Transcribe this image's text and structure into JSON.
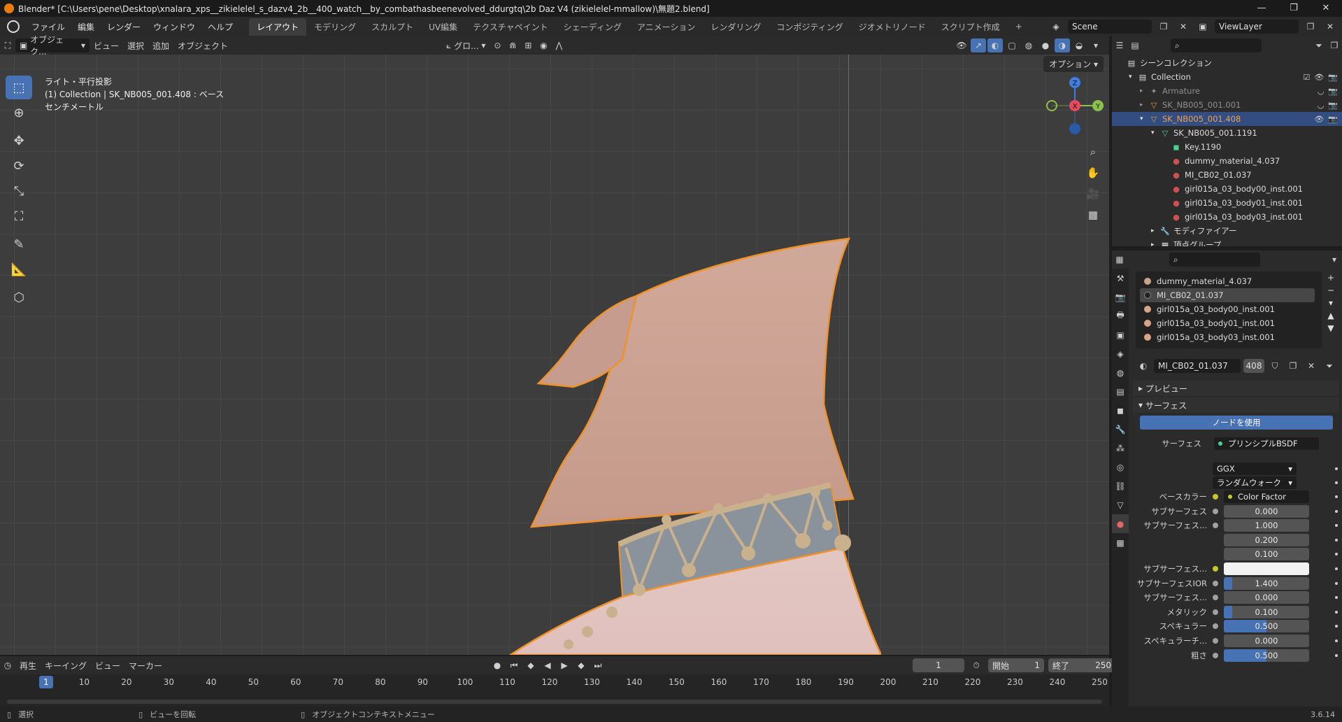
{
  "window": {
    "title": "Blender* [C:\\Users\\pene\\Desktop\\xnalara_xps__zikielelel_s_dazv4_2b__400_watch__by_combathasbeenevolved_ddurgtq\\2b Daz V4 (zikielelel-mmallow)\\無題2.blend]",
    "controls": [
      "—",
      "❐",
      "✕"
    ]
  },
  "menubar": {
    "items": [
      "ファイル",
      "編集",
      "レンダー",
      "ウィンドウ",
      "ヘルプ"
    ],
    "workspaces": [
      "レイアウト",
      "モデリング",
      "スカルプト",
      "UV編集",
      "テクスチャペイント",
      "シェーディング",
      "アニメーション",
      "レンダリング",
      "コンポジティング",
      "ジオメトリノード",
      "スクリプト作成"
    ],
    "active_workspace": "レイアウト",
    "add_tab": "+",
    "scene": "Scene",
    "view_layer": "ViewLayer"
  },
  "viewport_header": {
    "mode": "オブジェク...",
    "menus": [
      "ビュー",
      "選択",
      "追加",
      "オブジェクト"
    ],
    "transform_orientation": "グロ...",
    "options": "オプション"
  },
  "viewport": {
    "info_lines": [
      "ライト・平行投影",
      "(1) Collection | SK_NB005_001.408 : ベース",
      "センチメートル"
    ],
    "gizmo": {
      "z": "Z",
      "x": "X",
      "y": "Y"
    },
    "colors": {
      "x": "#e84a5f",
      "y": "#8bc34a",
      "z": "#3d7fe0",
      "selection_outline": "#f0912a"
    }
  },
  "timeline": {
    "menus": [
      "再生",
      "キーイング",
      "ビュー",
      "マーカー"
    ],
    "current_frame": "1",
    "start_label": "開始",
    "start": "1",
    "end_label": "終了",
    "end": "250",
    "ticks": [
      "1",
      "10",
      "20",
      "30",
      "40",
      "50",
      "60",
      "70",
      "80",
      "90",
      "100",
      "110",
      "120",
      "130",
      "140",
      "150",
      "160",
      "170",
      "180",
      "190",
      "200",
      "210",
      "220",
      "230",
      "240",
      "250"
    ]
  },
  "statusbar": {
    "items": [
      "選択",
      "ビューを回転",
      "オブジェクトコンテキストメニュー"
    ],
    "version": "3.6.14"
  },
  "outliner": {
    "rows": [
      {
        "label": "シーンコレクション",
        "icon": "scene-collection-icon",
        "glyph": "▤"
      },
      {
        "label": "Collection",
        "icon": "collection-icon",
        "glyph": "▤"
      },
      {
        "label": "Armature",
        "icon": "armature-icon",
        "glyph": "✦"
      },
      {
        "label": "SK_NB005_001.001",
        "icon": "mesh-object-icon",
        "glyph": "▽"
      },
      {
        "label": "SK_NB005_001.408",
        "icon": "mesh-object-icon",
        "glyph": "▽"
      },
      {
        "label": "SK_NB005_001.1191",
        "icon": "mesh-data-icon",
        "glyph": "▽"
      },
      {
        "label": "Key.1190",
        "icon": "shape-key-icon",
        "glyph": "◼"
      },
      {
        "label": "dummy_material_4.037",
        "icon": "material-icon",
        "glyph": "●"
      },
      {
        "label": "MI_CB02_01.037",
        "icon": "material-icon",
        "glyph": "●"
      },
      {
        "label": "girl015a_03_body00_inst.001",
        "icon": "material-icon",
        "glyph": "●"
      },
      {
        "label": "girl015a_03_body01_inst.001",
        "icon": "material-icon",
        "glyph": "●"
      },
      {
        "label": "girl015a_03_body03_inst.001",
        "icon": "material-icon",
        "glyph": "●"
      },
      {
        "label": "モディファイアー",
        "icon": "modifier-icon",
        "glyph": "🔧"
      },
      {
        "label": "頂点グループ",
        "icon": "vertex-group-icon",
        "glyph": "▦"
      }
    ]
  },
  "properties": {
    "material_slots": [
      {
        "name": "dummy_material_4.037",
        "color": "#c9a48a"
      },
      {
        "name": "MI_CB02_01.037",
        "color": "#222222"
      },
      {
        "name": "girl015a_03_body00_inst.001",
        "color": "#d9a589"
      },
      {
        "name": "girl015a_03_body01_inst.001",
        "color": "#d9a589"
      },
      {
        "name": "girl015a_03_body03_inst.001",
        "color": "#d9a589"
      }
    ],
    "material_name": "MI_CB02_01.037",
    "user_count": "408",
    "preview_label": "プレビュー",
    "surface_label": "サーフェス",
    "use_nodes": "ノードを使用",
    "surface_shader_label": "サーフェス",
    "surface_shader": "プリンシプルBSDF",
    "distribution": "GGX",
    "subsurface_method": "ランダムウォーク",
    "params": [
      {
        "label": "ベースカラー",
        "value": "Color Factor",
        "kind": "link"
      },
      {
        "label": "サブサーフェス",
        "value": "0.000",
        "fill": 0
      },
      {
        "label": "サブサーフェス...",
        "value": "1.000",
        "fill": 0
      },
      {
        "label": "",
        "value": "0.200",
        "fill": 0
      },
      {
        "label": "",
        "value": "0.100",
        "fill": 0
      },
      {
        "label": "サブサーフェス...",
        "value": "",
        "kind": "color",
        "color": "#f2f2f2"
      },
      {
        "label": "サブサーフェスIOR",
        "value": "1.400",
        "fill": 0.1
      },
      {
        "label": "サブサーフェス...",
        "value": "0.000",
        "fill": 0
      },
      {
        "label": "メタリック",
        "value": "0.100",
        "fill": 0.1
      },
      {
        "label": "スペキュラー",
        "value": "0.500",
        "fill": 0.5
      },
      {
        "label": "スペキュラーチ...",
        "value": "0.000",
        "fill": 0
      },
      {
        "label": "粗さ",
        "value": "0.500",
        "fill": 0.5
      }
    ]
  }
}
